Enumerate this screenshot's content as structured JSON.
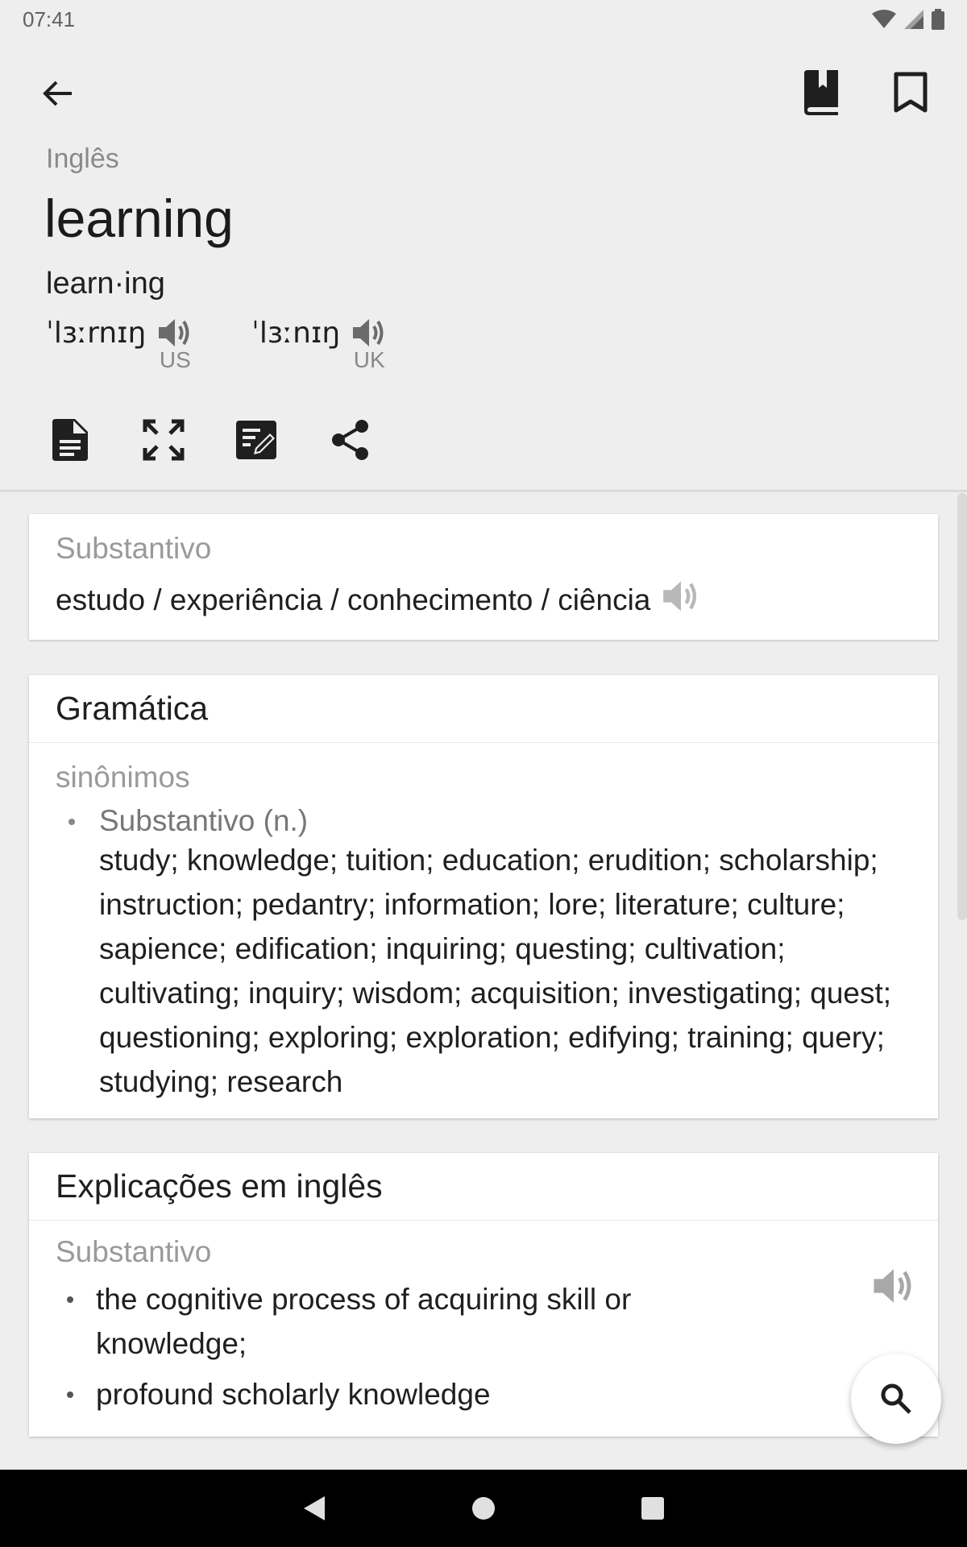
{
  "status_bar": {
    "time": "07:41"
  },
  "header": {
    "language": "Inglês",
    "word": "learning",
    "syllables": "learn·ing",
    "pronunciations": [
      {
        "ipa": "ˈlɜːrnɪŋ",
        "region": "US"
      },
      {
        "ipa": "ˈlɜːnɪŋ",
        "region": "UK"
      }
    ],
    "icons": {
      "back": "arrow-back-icon",
      "wordbook": "book-icon",
      "bookmark": "bookmark-icon",
      "doc": "document-icon",
      "fullscreen": "fullscreen-icon",
      "note": "edit-note-icon",
      "share": "share-icon"
    }
  },
  "translation_card": {
    "part_of_speech": "Substantivo",
    "meaning": "estudo / experiência / conhecimento / ciência"
  },
  "grammar_card": {
    "title": "Gramática",
    "section": "sinônimos",
    "part_of_speech": "Substantivo (n.)",
    "synonyms": "study; knowledge; tuition; education; erudition; scholarship; instruction; pedantry; information; lore; literature; culture; sapience; edification; inquiring; questing; cultivation; cultivating; inquiry; wisdom; acquisition; investigating; quest; questioning; exploring; exploration; edifying; training; query; studying; research"
  },
  "explanations_card": {
    "title": "Explicações em inglês",
    "part_of_speech": "Substantivo",
    "definitions": [
      "the cognitive process of acquiring skill or knowledge;",
      "profound scholarly knowledge"
    ]
  },
  "colors": {
    "background": "#eeeeee",
    "card": "#ffffff",
    "muted": "#9a9a9a"
  }
}
